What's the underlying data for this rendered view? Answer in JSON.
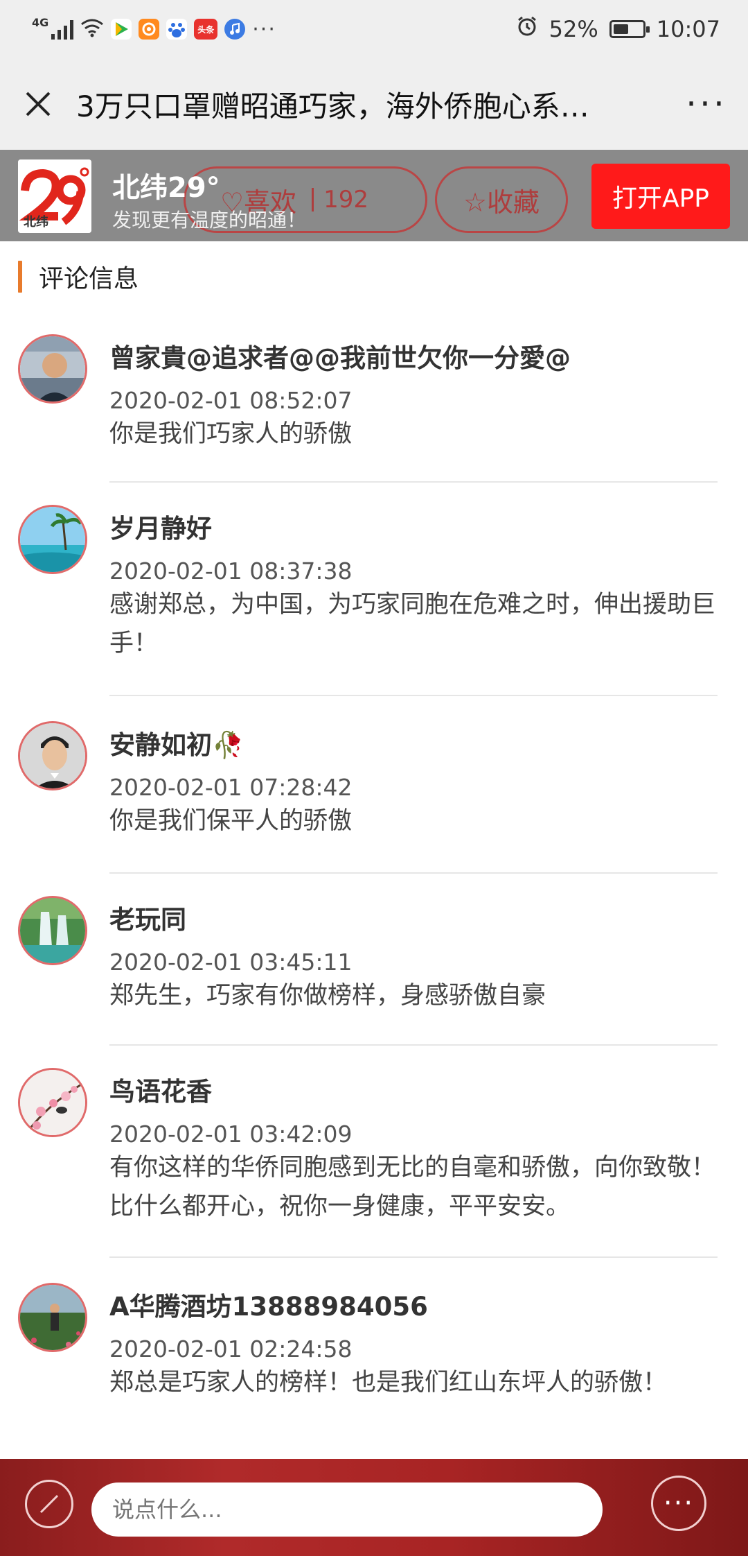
{
  "status_bar": {
    "network": "4G",
    "battery": "52%",
    "time": "10:07",
    "battery_level": 0.52,
    "overflow": "···",
    "toutiao_label": "头条"
  },
  "header": {
    "title": "3万只口罩赠昭通巧家，海外侨胞心系…",
    "more": "···"
  },
  "banner": {
    "logo_text": "北纬",
    "brand_name": "北纬29°",
    "brand_sub": "发现更有温度的昭通！",
    "like_label": "♡喜欢",
    "like_count": "192",
    "favorite_label": "☆收藏",
    "open_app": "打开APP",
    "accent_color": "#ff1a1a"
  },
  "section": {
    "title": "评论信息"
  },
  "comments": [
    {
      "name": "曾家貴@追求者@@我前世欠你一分愛@",
      "time": "2020-02-01 08:52:07",
      "text": "你是我们巧家人的骄傲",
      "avatar": "person-avatar"
    },
    {
      "name": "岁月静好",
      "time": "2020-02-01 08:37:38",
      "text": "感谢郑总，为中国，为巧家同胞在危难之时，伸出援助巨手！",
      "avatar": "beach-avatar"
    },
    {
      "name": "安静如初🥀",
      "time": "2020-02-01 07:28:42",
      "text": "你是我们保平人的骄傲",
      "avatar": "portrait-avatar"
    },
    {
      "name": "老玩同",
      "time": "2020-02-01 03:45:11",
      "text": "郑先生，巧家有你做榜样，身感骄傲自豪",
      "avatar": "waterfall-avatar"
    },
    {
      "name": "鸟语花香",
      "time": "2020-02-01 03:42:09",
      "text": "有你这样的华侨同胞感到无比的自毫和骄傲，向你致敬！比什么都开心，祝你一身健康，平平安安。",
      "avatar": "blossom-avatar"
    },
    {
      "name": "A华腾酒坊13888984056",
      "time": "2020-02-01 02:24:58",
      "text": "郑总是巧家人的榜样！也是我们红山东坪人的骄傲！",
      "avatar": "field-avatar"
    }
  ],
  "bottom_bar": {
    "input_placeholder": "说点什么...",
    "menu": "···"
  }
}
